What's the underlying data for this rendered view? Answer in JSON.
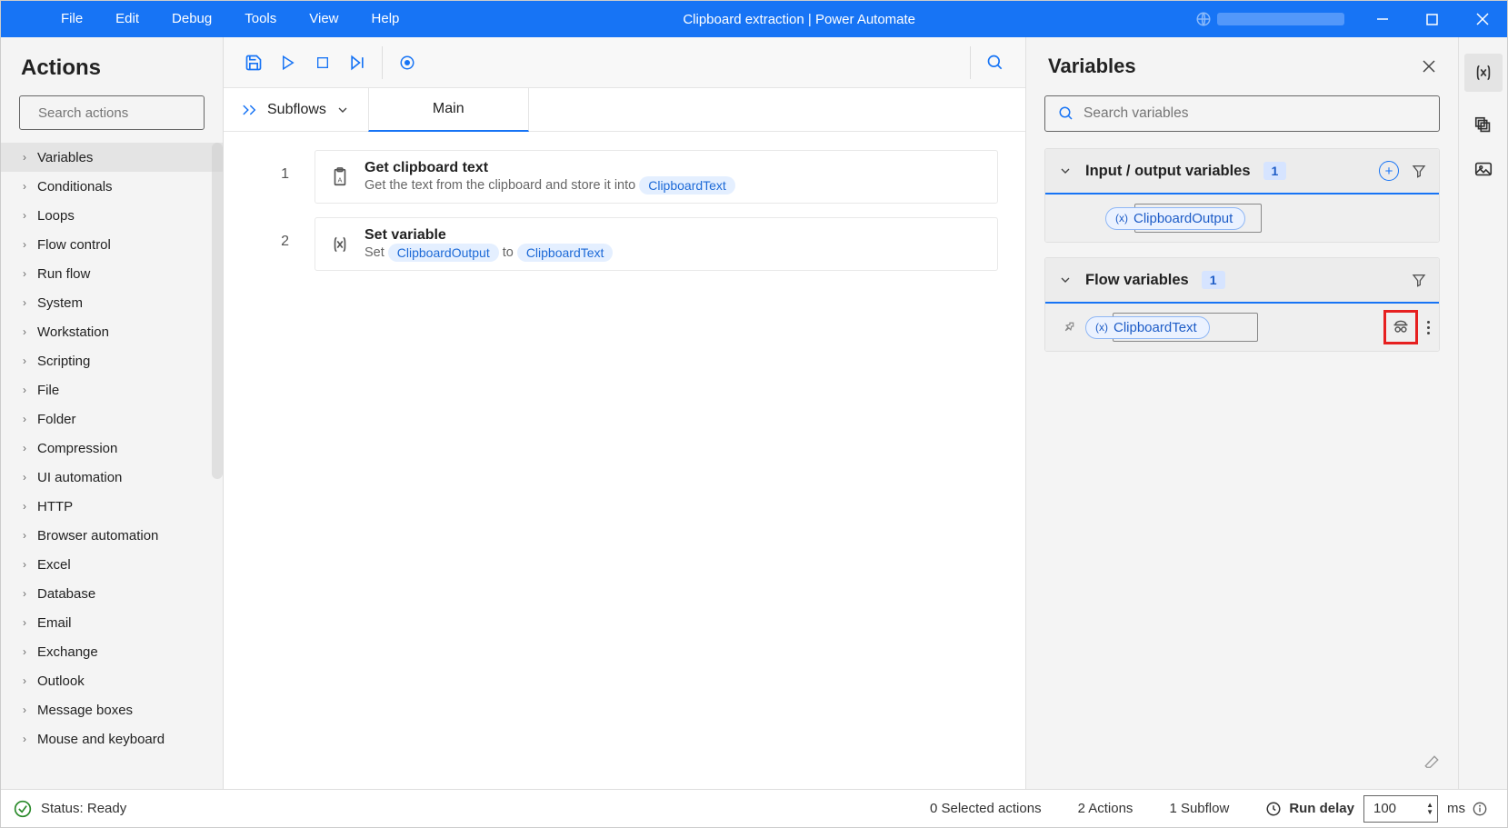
{
  "titlebar": {
    "menu": [
      "File",
      "Edit",
      "Debug",
      "Tools",
      "View",
      "Help"
    ],
    "title": "Clipboard extraction | Power Automate"
  },
  "actions_pane": {
    "heading": "Actions",
    "search_placeholder": "Search actions",
    "categories": [
      "Variables",
      "Conditionals",
      "Loops",
      "Flow control",
      "Run flow",
      "System",
      "Workstation",
      "Scripting",
      "File",
      "Folder",
      "Compression",
      "UI automation",
      "HTTP",
      "Browser automation",
      "Excel",
      "Database",
      "Email",
      "Exchange",
      "Outlook",
      "Message boxes",
      "Mouse and keyboard"
    ]
  },
  "subflows_label": "Subflows",
  "main_tab": "Main",
  "steps": [
    {
      "title": "Get clipboard text",
      "desc_prefix": "Get the text from the clipboard and store it into",
      "token": "ClipboardText"
    },
    {
      "title": "Set variable",
      "set_word": "Set",
      "token1": "ClipboardOutput",
      "to_word": "to",
      "token2": "ClipboardText"
    }
  ],
  "variables_pane": {
    "heading": "Variables",
    "search_placeholder": "Search variables",
    "io_section": {
      "title": "Input / output variables",
      "count": "1",
      "chip": "ClipboardOutput"
    },
    "flow_section": {
      "title": "Flow variables",
      "count": "1",
      "chip": "ClipboardText"
    }
  },
  "statusbar": {
    "status": "Status: Ready",
    "selected": "0 Selected actions",
    "actions": "2 Actions",
    "subflow": "1 Subflow",
    "run_delay_label": "Run delay",
    "run_delay_value": "100",
    "ms": "ms"
  }
}
